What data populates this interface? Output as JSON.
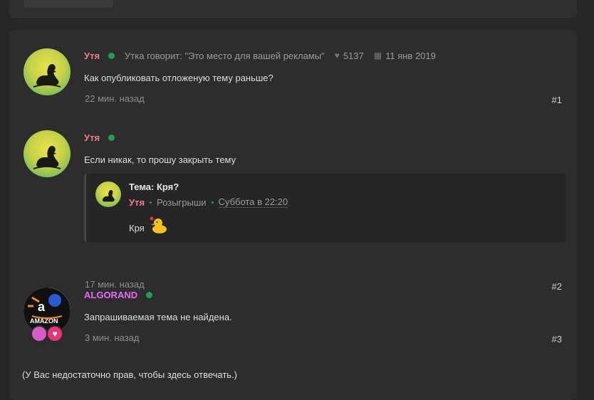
{
  "posts": [
    {
      "author": "Утя",
      "status_text": "Утка говорит: \"Это место для вашей рекламы\"",
      "likes": "5137",
      "reg_date": "11 янв 2019",
      "message": "Как опубликовать отложеную тему раньше?",
      "time": "22 мин. назад",
      "number": "#1"
    },
    {
      "author": "Утя",
      "message": "Если никак, то прошу закрыть тему",
      "time": "17 мин. назад",
      "number": "#2",
      "quote": {
        "title": "Тема: Кря?",
        "author": "Утя",
        "forum": "Розыгрыши",
        "date": "Суббота в 22:20",
        "text": "Кря"
      }
    },
    {
      "author": "ALGORAND",
      "message": "Запрашиваемая тема не найдена.",
      "time": "3 мин. назад",
      "number": "#3"
    }
  ],
  "footer_note": "(У Вас недостаточно прав, чтобы здесь отвечать.)",
  "colors": {
    "author_duck": "#f07a8d",
    "author_algorand": "#e96bf5",
    "online": "#1f9e56"
  }
}
